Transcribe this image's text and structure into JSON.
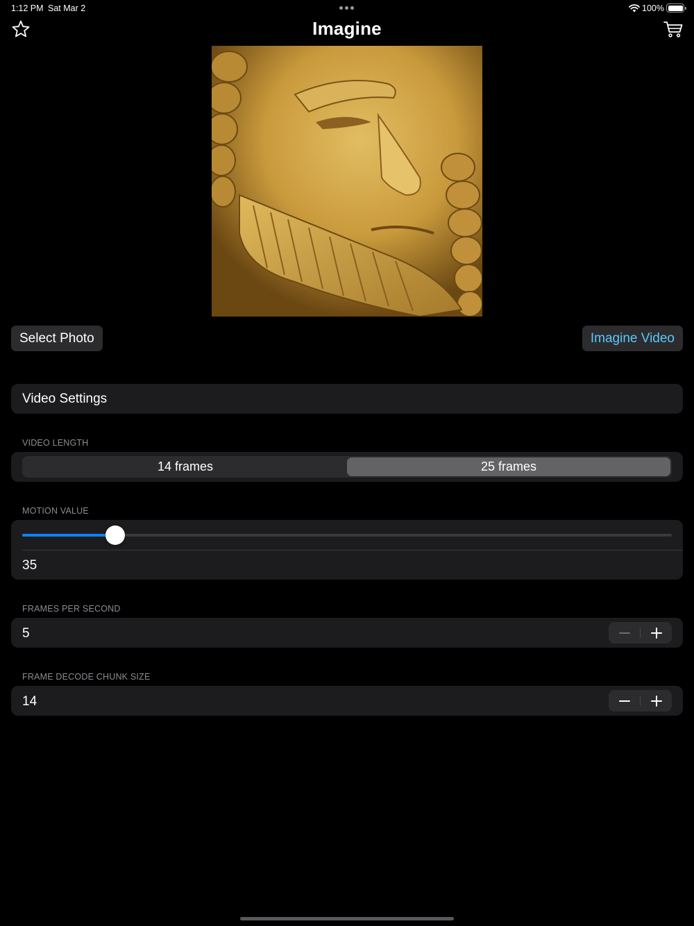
{
  "status_bar": {
    "time": "1:12 PM",
    "date": "Sat Mar 2",
    "battery_percent": "100%",
    "battery_level": 1.0,
    "wifi_icon": "wifi-icon",
    "battery_icon": "battery-icon"
  },
  "nav": {
    "title": "Imagine",
    "left_icon": "star-icon",
    "right_icon": "cart-icon"
  },
  "preview": {
    "content": "sand sculpture face photo"
  },
  "actions": {
    "select_photo_label": "Select Photo",
    "imagine_video_label": "Imagine Video"
  },
  "settings": {
    "header": "Video Settings",
    "video_length": {
      "label": "VIDEO LENGTH",
      "options": [
        "14 frames",
        "25 frames"
      ],
      "selected": "25 frames"
    },
    "motion": {
      "label": "MOTION VALUE",
      "value": "35",
      "slider_fraction": 0.143
    },
    "fps": {
      "label": "FRAMES PER SECOND",
      "value": "5",
      "minus_enabled": false,
      "plus_enabled": true
    },
    "chunk": {
      "label": "FRAME DECODE CHUNK SIZE",
      "value": "14",
      "minus_enabled": true,
      "plus_enabled": true
    }
  },
  "colors": {
    "accent_blue": "#0a84ff",
    "link_cyan": "#5ac8fa",
    "card_bg": "#1c1c1e",
    "control_bg": "#2c2c2e",
    "selected_segment": "#636366",
    "secondary_label": "#8d8d93"
  }
}
